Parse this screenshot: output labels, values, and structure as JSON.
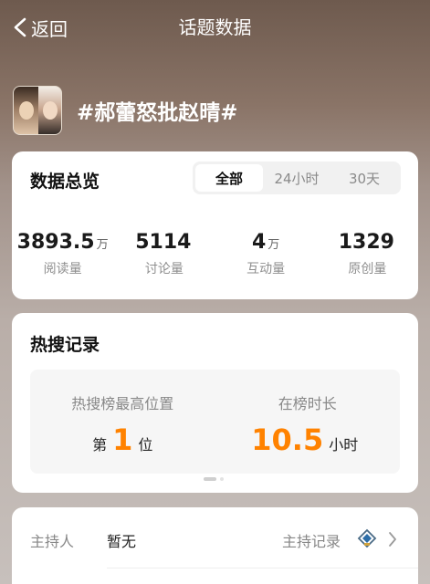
{
  "nav": {
    "back_label": "返回",
    "title": "话题数据"
  },
  "topic": {
    "title": "#郝蕾怒批赵晴#"
  },
  "overview": {
    "title": "数据总览",
    "tabs": [
      {
        "label": "全部",
        "active": true
      },
      {
        "label": "24小时",
        "active": false
      },
      {
        "label": "30天",
        "active": false
      }
    ],
    "stats": [
      {
        "value": "3893.5",
        "unit": "万",
        "label": "阅读量"
      },
      {
        "value": "5114",
        "unit": "",
        "label": "讨论量"
      },
      {
        "value": "4",
        "unit": "万",
        "label": "互动量"
      },
      {
        "value": "1329",
        "unit": "",
        "label": "原创量"
      }
    ]
  },
  "hot_search": {
    "title": "热搜记录",
    "peak": {
      "label": "热搜榜最高位置",
      "prefix": "第",
      "value": "1",
      "suffix": "位"
    },
    "duration": {
      "label": "在榜时长",
      "value": "10.5",
      "unit": "小时"
    }
  },
  "host": {
    "label": "主持人",
    "value": "暂无",
    "record_label": "主持记录"
  },
  "colors": {
    "accent": "#ff8200",
    "card": "#ffffff",
    "muted": "#888888"
  },
  "icons": {
    "back": "chevron-left-icon",
    "badge": "host-badge-icon",
    "arrow": "chevron-right-icon"
  }
}
